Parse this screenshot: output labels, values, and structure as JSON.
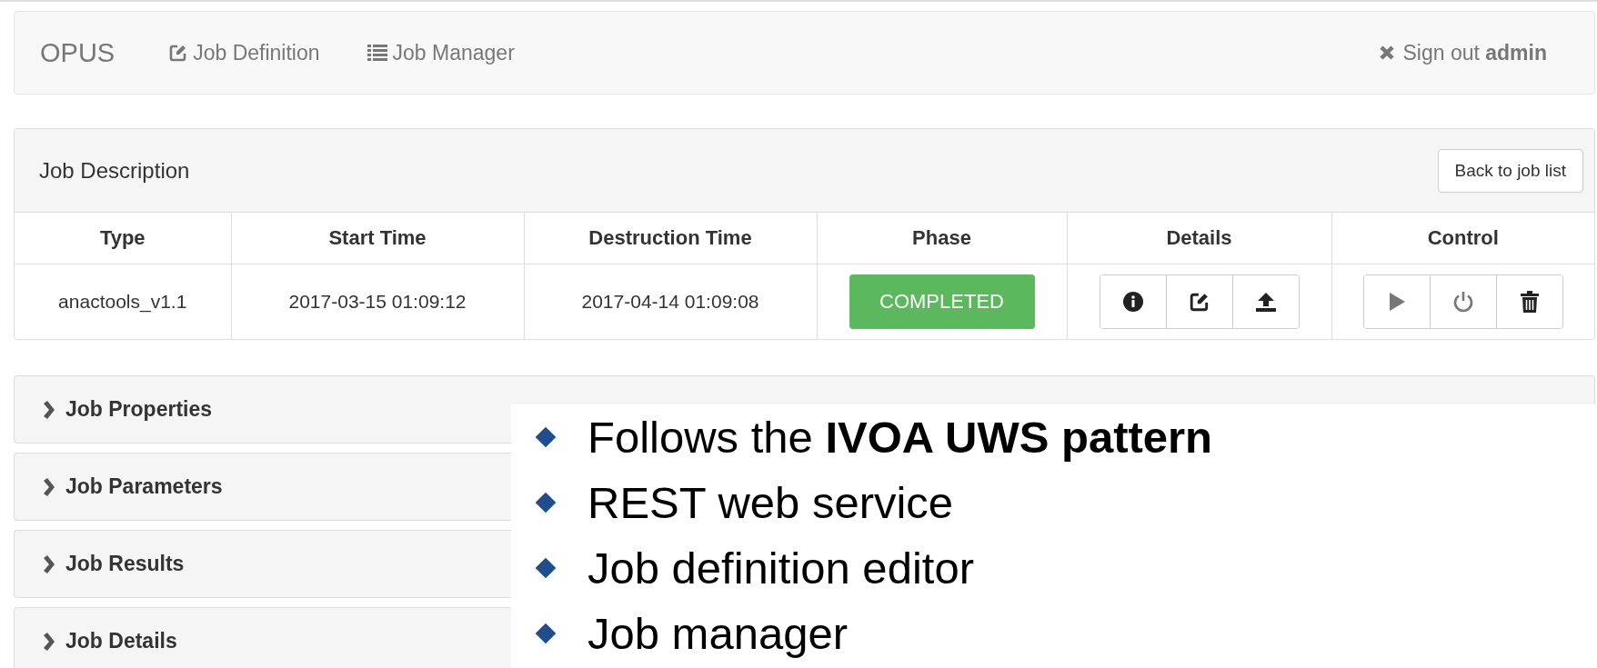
{
  "navbar": {
    "brand": "OPUS",
    "links": [
      {
        "label": "Job Definition"
      },
      {
        "label": "Job Manager"
      }
    ],
    "signout": "Sign out **admin**"
  },
  "job_description": {
    "title": "Job Description",
    "back_button": "Back to job list",
    "columns": [
      "Type",
      "Start Time",
      "Destruction Time",
      "Phase",
      "Details",
      "Control"
    ],
    "rows": [
      {
        "type": "anactools_v1.1",
        "start_time": "2017-03-15 01:09:12",
        "destruction_time": "2017-04-14 01:09:08",
        "phase": "COMPLETED"
      }
    ]
  },
  "panels": [
    {
      "title": "Job Properties",
      "expanded": false
    },
    {
      "title": "Job Parameters",
      "expanded": false
    },
    {
      "title": "Job Results",
      "expanded": false
    },
    {
      "title": "Job Details",
      "expanded": false
    }
  ],
  "bullets": [
    "Follows the **IVOA UWS pattern**",
    "REST web service",
    "Job definition editor",
    "Job manager"
  ]
}
